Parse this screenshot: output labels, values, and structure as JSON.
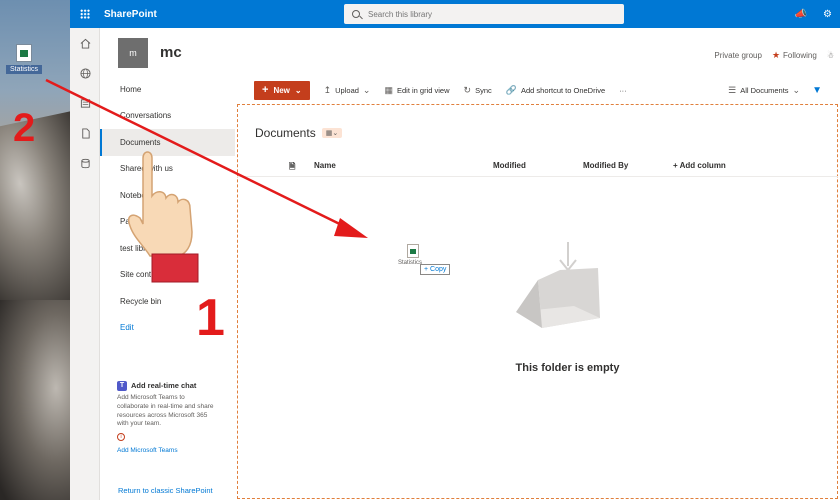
{
  "desktop": {
    "icon_label": "Statistics"
  },
  "suite": {
    "title": "SharePoint",
    "search_placeholder": "Search this library"
  },
  "site": {
    "logo_text": "m",
    "name": "mc",
    "privacy": "Private group",
    "follow_label": "Following"
  },
  "nav": {
    "items": [
      {
        "label": "Home"
      },
      {
        "label": "Conversations"
      },
      {
        "label": "Documents"
      },
      {
        "label": "Shared with us"
      },
      {
        "label": "Notebook"
      },
      {
        "label": "Pages"
      },
      {
        "label": "test library"
      },
      {
        "label": "Site contents"
      },
      {
        "label": "Recycle bin"
      },
      {
        "label": "Edit"
      }
    ],
    "teams_title": "Add real-time chat",
    "teams_body": "Add Microsoft Teams to collaborate in real-time and share resources across Microsoft 365 with your team.",
    "teams_link": "Add Microsoft Teams",
    "classic_link": "Return to classic SharePoint"
  },
  "commands": {
    "new": "New",
    "upload": "Upload",
    "grid": "Edit in grid view",
    "sync": "Sync",
    "shortcut": "Add shortcut to OneDrive",
    "more": "···",
    "view": "All Documents"
  },
  "library": {
    "title": "Documents",
    "columns": [
      "Name",
      "Modified",
      "Modified By",
      "+ Add column"
    ],
    "drag_label": "Statistics",
    "copy_label": "+ Copy",
    "empty_text": "This folder is empty"
  },
  "annotations": {
    "step1": "1",
    "step2": "2"
  },
  "colors": {
    "accent": "#0078d4",
    "new_button": "#c43e1c",
    "annotation": "#e31b1b",
    "dropzone": "#e07f3c"
  }
}
